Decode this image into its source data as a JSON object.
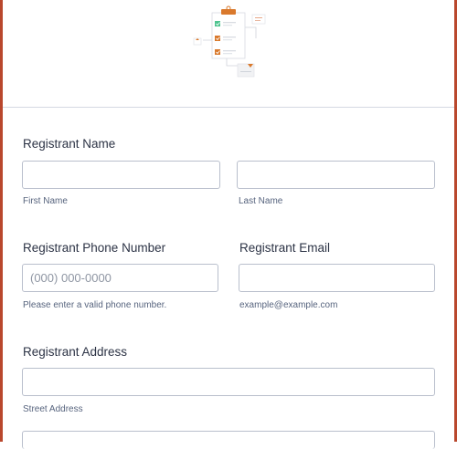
{
  "form": {
    "registrant_name": {
      "label": "Registrant Name",
      "first_sublabel": "First Name",
      "last_sublabel": "Last Name",
      "first_value": "",
      "last_value": ""
    },
    "registrant_phone": {
      "label": "Registrant Phone Number",
      "placeholder": "(000) 000-0000",
      "sublabel": "Please enter a valid phone number.",
      "value": ""
    },
    "registrant_email": {
      "label": "Registrant Email",
      "sublabel": "example@example.com",
      "value": ""
    },
    "registrant_address": {
      "label": "Registrant Address",
      "street_sublabel": "Street Address",
      "street_value": ""
    }
  },
  "colors": {
    "frame": "#b9472d",
    "accent": "#d9792c",
    "check_green": "#4fc48f"
  }
}
